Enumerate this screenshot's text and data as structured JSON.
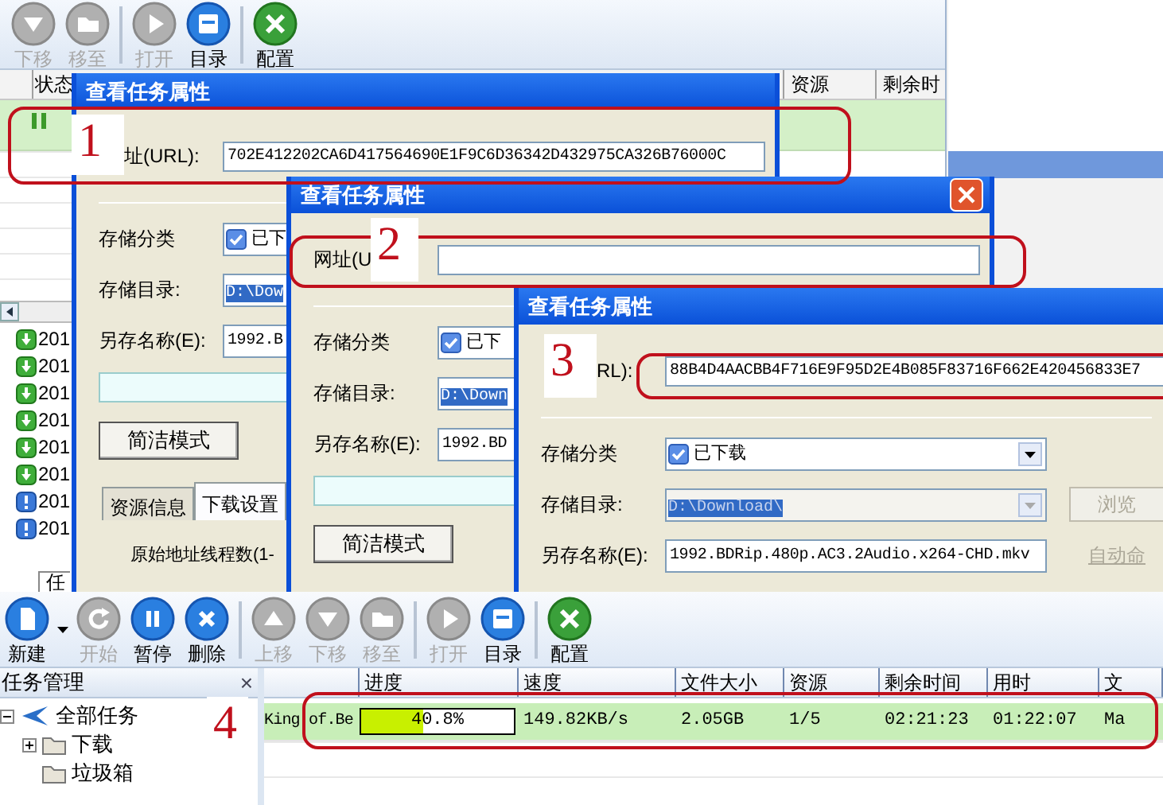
{
  "top_app": {
    "toolbar": [
      {
        "label": "下移",
        "kind": "down",
        "disabled": true
      },
      {
        "label": "移至",
        "kind": "folder",
        "disabled": true
      },
      {
        "label": "打开",
        "kind": "play",
        "disabled": true,
        "sep_before": true
      },
      {
        "label": "目录",
        "kind": "list",
        "disabled": false
      },
      {
        "label": "配置",
        "kind": "tools",
        "disabled": false,
        "sep_before": true
      }
    ],
    "columns": [
      "状态",
      "资源",
      "剩余时"
    ],
    "rows": [
      {
        "kind": "paused"
      }
    ],
    "side_list": [
      {
        "kind": "done",
        "text": "201"
      },
      {
        "kind": "done",
        "text": "201"
      },
      {
        "kind": "done",
        "text": "201"
      },
      {
        "kind": "done",
        "text": "201"
      },
      {
        "kind": "done",
        "text": "201"
      },
      {
        "kind": "done",
        "text": "201"
      },
      {
        "kind": "error",
        "text": "201"
      },
      {
        "kind": "error",
        "text": "201"
      }
    ],
    "tab": "任"
  },
  "dialogs": [
    {
      "title": "查看任务属性",
      "url_label": "址(URL):",
      "url_value": "702E412202CA6D417564690E1F9C6D36342D432975CA326B76000C",
      "fields": [
        {
          "label": "存储分类",
          "kind": "category",
          "value": "已下",
          "checked": true
        },
        {
          "label": "存储目录:",
          "kind": "dir",
          "value": "D:\\Dow"
        },
        {
          "label": "另存名称(E):",
          "kind": "name",
          "value": "1992.B"
        }
      ],
      "status_box": true,
      "mode_button": "简洁模式",
      "tabs": [
        {
          "label": "资源信息",
          "selected": false
        },
        {
          "label": "下载设置",
          "selected": true
        }
      ],
      "thread_label": "原始地址线程数(1-"
    },
    {
      "title": "查看任务属性",
      "url_label": "网址(U",
      "close": true,
      "fields": [
        {
          "label": "存储分类",
          "kind": "category",
          "value": "已下",
          "checked": true
        },
        {
          "label": "存储目录:",
          "kind": "dir",
          "value": "D:\\Down"
        },
        {
          "label": "另存名称(E):",
          "kind": "name",
          "value": "1992.BD"
        }
      ],
      "status_box": true,
      "mode_button": "简洁模式"
    },
    {
      "title": "查看任务属性",
      "url_label": "RL):",
      "url_value": "88B4D4AACBB4F716E9F95D2E4B085F83716F662E420456833E7",
      "fields": [
        {
          "label": "存储分类",
          "kind": "category",
          "value": "已下载",
          "checked": true,
          "dropdown": true
        },
        {
          "label": "存储目录:",
          "kind": "dir",
          "value": "D:\\Download\\",
          "dropdown": true,
          "disabled": true,
          "button": {
            "label": "浏览",
            "disabled": true
          }
        },
        {
          "label": "另存名称(E):",
          "kind": "name",
          "value": "1992.BDRip.480p.AC3.2Audio.x264-CHD.mkv",
          "link": {
            "label": "自动命",
            "disabled": true
          }
        }
      ]
    }
  ],
  "main_app": {
    "toolbar": [
      {
        "label": "新建",
        "kind": "new",
        "disabled": false,
        "split": true
      },
      {
        "label": "开始",
        "kind": "refresh",
        "disabled": true
      },
      {
        "label": "暂停",
        "kind": "pause",
        "disabled": false
      },
      {
        "label": "删除",
        "kind": "delete",
        "disabled": false
      },
      {
        "label": "上移",
        "kind": "up",
        "disabled": true,
        "sep_before": true
      },
      {
        "label": "下移",
        "kind": "down",
        "disabled": true
      },
      {
        "label": "移至",
        "kind": "folder",
        "disabled": true
      },
      {
        "label": "打开",
        "kind": "play",
        "disabled": true,
        "sep_before": true
      },
      {
        "label": "目录",
        "kind": "list",
        "disabled": false
      },
      {
        "label": "配置",
        "kind": "tools",
        "disabled": false,
        "sep_before": true
      }
    ],
    "panel_title": "任务管理",
    "panel_close": "×",
    "tree": [
      {
        "label": "全部任务",
        "expanded": true,
        "children": [
          {
            "label": "下载",
            "expanded": false
          },
          {
            "label": "垃圾箱"
          }
        ]
      }
    ],
    "columns": [
      "进度",
      "速度",
      "文件大小",
      "资源",
      "剩余时间",
      "用时",
      "文"
    ],
    "rows": [
      {
        "name": "King.of.Be",
        "progress": {
          "level": 0.408,
          "text": "40.8%"
        },
        "speed": "149.82KB/s",
        "size": "2.05GB",
        "sources": "1/5",
        "remaining": "02:21:23",
        "elapsed": "01:22:07",
        "file": "Ma"
      }
    ]
  },
  "annotations": [
    {
      "label": "1"
    },
    {
      "label": "2"
    },
    {
      "label": "3"
    },
    {
      "label": "4"
    }
  ]
}
